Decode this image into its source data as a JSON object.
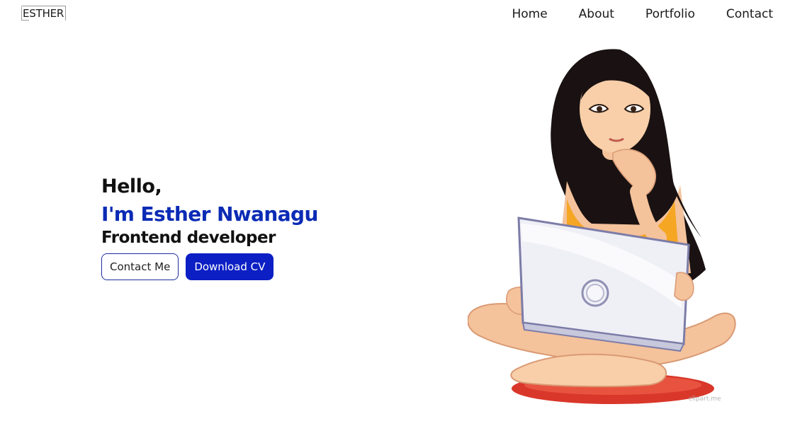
{
  "header": {
    "logo_first": "E",
    "logo_rest": "STHER",
    "nav": [
      {
        "label": "Home"
      },
      {
        "label": "About"
      },
      {
        "label": "Portfolio"
      },
      {
        "label": "Contact"
      }
    ]
  },
  "hero": {
    "greeting": "Hello,",
    "name": "I'm Esther Nwanagu",
    "role": "Frontend developer",
    "contact_button": "Contact Me",
    "download_button": "Download CV"
  },
  "illustration": {
    "watermark": "clipart.me"
  },
  "colors": {
    "accent": "#0b1fc4",
    "name_text": "#0b2bb5"
  }
}
